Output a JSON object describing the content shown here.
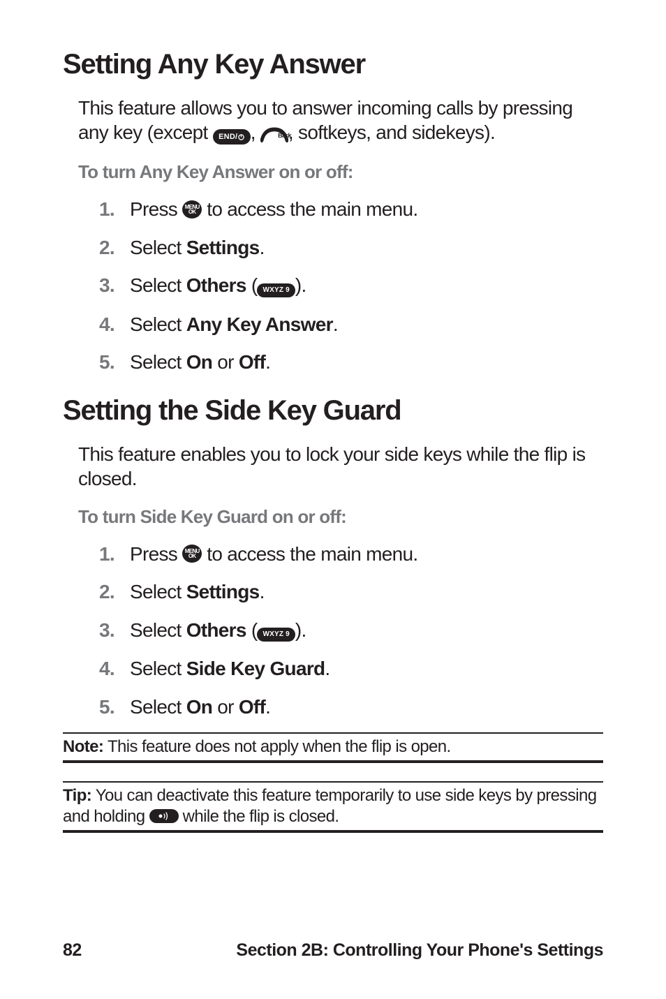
{
  "section1": {
    "title": "Setting Any Key Answer",
    "intro_pre": "This feature allows you to answer incoming calls by pressing any key (except ",
    "intro_mid1": ", ",
    "intro_mid2": ", softkeys, and sidekeys).",
    "subhead": "To turn Any Key Answer on or off:",
    "steps": [
      {
        "num": "1.",
        "pre": "Press ",
        "post": " to access the main menu.",
        "icon": "menu"
      },
      {
        "num": "2.",
        "pre": "Select ",
        "bold": "Settings",
        "post": "."
      },
      {
        "num": "3.",
        "pre": "Select ",
        "bold": "Others",
        "post_pre": " (",
        "post_post": ").",
        "icon": "wxyz9"
      },
      {
        "num": "4.",
        "pre": "Select ",
        "bold": "Any Key Answer",
        "post": "."
      },
      {
        "num": "5.",
        "pre": "Select ",
        "bold": "On",
        "mid": " or ",
        "bold2": "Off",
        "post": "."
      }
    ]
  },
  "section2": {
    "title": "Setting the Side Key Guard",
    "intro": "This feature enables you to lock your side keys while the flip is closed.",
    "subhead": "To turn Side Key Guard on or off:",
    "steps": [
      {
        "num": "1.",
        "pre": "Press ",
        "post": " to access the main menu.",
        "icon": "menu"
      },
      {
        "num": "2.",
        "pre": "Select ",
        "bold": "Settings",
        "post": "."
      },
      {
        "num": "3.",
        "pre": "Select ",
        "bold": "Others",
        "post_pre": " (",
        "post_post": ").",
        "icon": "wxyz9"
      },
      {
        "num": "4.",
        "pre": "Select ",
        "bold": "Side Key Guard",
        "post": "."
      },
      {
        "num": "5.",
        "pre": "Select ",
        "bold": "On",
        "mid": " or ",
        "bold2": "Off",
        "post": "."
      }
    ]
  },
  "note": {
    "label": "Note:",
    "text": " This feature does not apply when the flip is open."
  },
  "tip": {
    "label": "Tip:",
    "text_pre": " You can deactivate this feature temporarily to use side keys by pressing and holding ",
    "text_post": " while the flip is closed."
  },
  "footer": {
    "page": "82",
    "section": "Section 2B: Controlling Your Phone's Settings"
  },
  "keys": {
    "end": "END/",
    "menu_top": "MENU",
    "menu_bot": "OK",
    "wxyz9": "WXYZ 9",
    "back": "Back"
  }
}
